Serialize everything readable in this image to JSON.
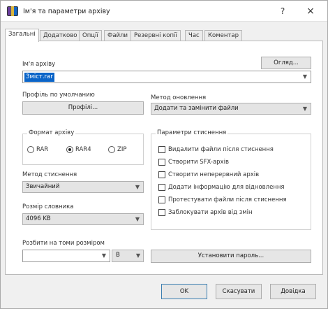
{
  "window": {
    "title": "Ім'я та параметри архіву",
    "help_glyph": "?",
    "close_glyph": "×"
  },
  "tabs": [
    {
      "label": "Загальні",
      "active": true
    },
    {
      "label": "Додатково",
      "active": false
    },
    {
      "label": "Опції",
      "active": false
    },
    {
      "label": "Файли",
      "active": false
    },
    {
      "label": "Резервні копії",
      "active": false
    },
    {
      "label": "Час",
      "active": false
    },
    {
      "label": "Коментар",
      "active": false
    }
  ],
  "archive_name": {
    "label": "Ім'я архіву",
    "browse_label": "Огляд...",
    "value": "Зміст.rar"
  },
  "profile": {
    "label": "Профіль по умолчанию",
    "button_label": "Профілі..."
  },
  "update_method": {
    "label": "Метод оновлення",
    "value": "Додати та замінити файли"
  },
  "archive_format": {
    "label": "Формат архіву",
    "options": [
      {
        "label": "RAR",
        "selected": false
      },
      {
        "label": "RAR4",
        "selected": true
      },
      {
        "label": "ZIP",
        "selected": false
      }
    ]
  },
  "compression_method": {
    "label": "Метод стиснення",
    "value": "Звичайний"
  },
  "dictionary_size": {
    "label": "Розмір словника",
    "value": "4096 KB"
  },
  "split_volumes": {
    "label": "Розбити на томи розміром",
    "value": "",
    "unit": "B"
  },
  "set_password_label": "Установити пароль...",
  "compression_options": {
    "label": "Параметри стиснення",
    "items": [
      {
        "label": "Видалити файли після стиснення",
        "checked": false
      },
      {
        "label": "Створити SFX-архів",
        "checked": false
      },
      {
        "label": "Створити неперервний архів",
        "checked": false
      },
      {
        "label": "Додати інформацію для відновлення",
        "checked": false
      },
      {
        "label": "Протестувати файли після стиснення",
        "checked": false
      },
      {
        "label": "Заблокувати архів від змін",
        "checked": false
      }
    ]
  },
  "footer": {
    "ok_label": "OK",
    "cancel_label": "Скасувати",
    "help_label": "Довідка"
  },
  "icons": {
    "dropdown": "▼",
    "app": "winrar-icon"
  },
  "colors": {
    "selection": "#0a64c8",
    "default_button_border": "#3c7fb1"
  }
}
